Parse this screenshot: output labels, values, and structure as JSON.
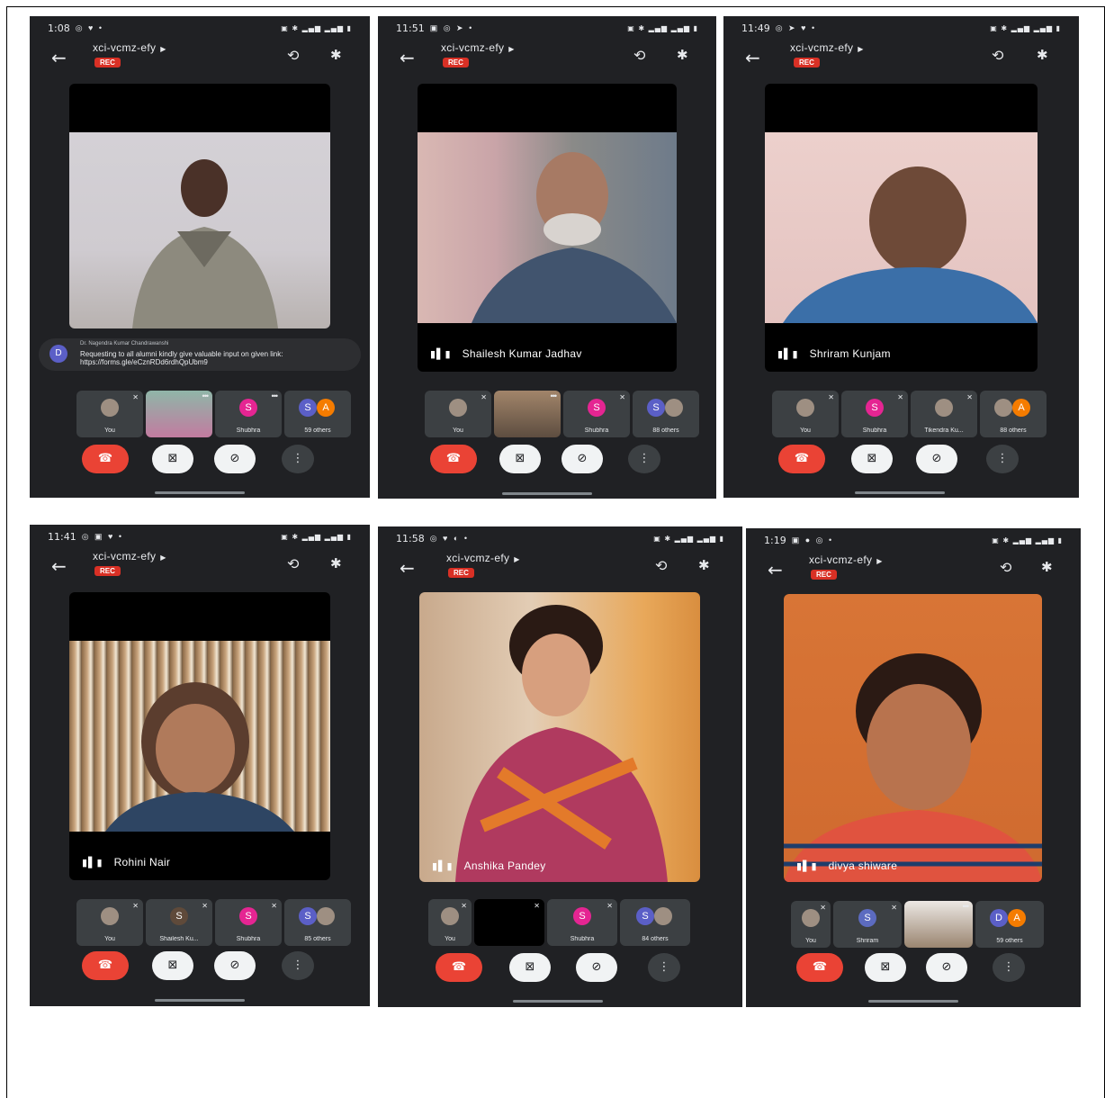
{
  "screens": [
    {
      "time": "1:08",
      "meeting_code": "xci-vcmz-efy",
      "rec": "REC",
      "caption": {
        "initial": "D",
        "name": "Dr. Nagendra Kumar Chandrawanshi",
        "text": "Requesting to all alumni kindly give valuable input on given link: https://forms.gle/eCznRDd6rdhQpUbm9"
      },
      "tiles": [
        "You",
        "",
        "Shubhra",
        "59 others"
      ]
    },
    {
      "time": "11:51",
      "meeting_code": "xci-vcmz-efy",
      "rec": "REC",
      "speaker": "Shailesh Kumar Jadhav",
      "tiles": [
        "You",
        "",
        "Shubhra",
        "88 others"
      ]
    },
    {
      "time": "11:49",
      "meeting_code": "xci-vcmz-efy",
      "rec": "REC",
      "speaker": "Shriram Kunjam",
      "tiles": [
        "You",
        "Shubhra",
        "Tikendra Ku...",
        "88 others"
      ]
    },
    {
      "time": "11:41",
      "meeting_code": "xci-vcmz-efy",
      "rec": "REC",
      "speaker": "Rohini Nair",
      "tiles": [
        "You",
        "Shailesh Ku...",
        "Shubhra",
        "85 others"
      ]
    },
    {
      "time": "11:58",
      "meeting_code": "xci-vcmz-efy",
      "rec": "REC",
      "speaker": "Anshika Pandey",
      "tiles": [
        "You",
        "",
        "Shubhra",
        "84 others"
      ]
    },
    {
      "time": "1:19",
      "meeting_code": "xci-vcmz-efy",
      "rec": "REC",
      "speaker": "divya shiware",
      "tiles": [
        "You",
        "Shriram",
        "",
        "59 others"
      ]
    }
  ],
  "avatar_letters": {
    "s": "S",
    "a": "A",
    "d": "D"
  },
  "colors": {
    "app_bg": "#202124",
    "end_call": "#ea4335",
    "rec": "#d93025",
    "avatar_pink": "#e52592",
    "avatar_blue": "#5b5fc7",
    "avatar_orange": "#f57c00"
  },
  "icons": [
    "back-arrow-icon",
    "camera-switch-icon",
    "bluetooth-icon",
    "end-call-icon",
    "camera-off-icon",
    "mic-off-icon",
    "more-options-icon",
    "audio-level-icon"
  ]
}
